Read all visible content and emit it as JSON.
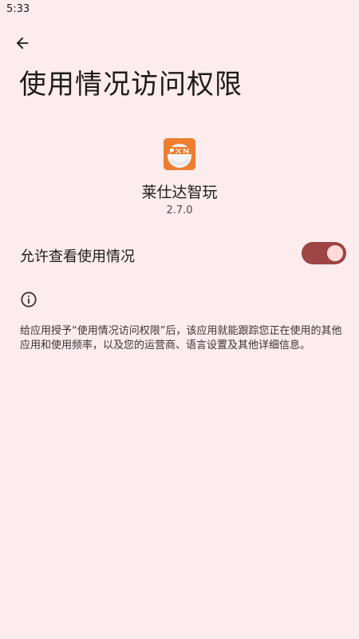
{
  "status_bar": {
    "time": "5:33"
  },
  "header": {
    "title": "使用情况访问权限"
  },
  "app": {
    "name": "莱仕达智玩",
    "version": "2.7.0",
    "icon_label": "PXN",
    "icon_color": "#ee7d2e"
  },
  "setting": {
    "label": "允许查看使用情况",
    "enabled": true,
    "toggle_color": "#9d4445"
  },
  "info": {
    "description": "给应用授予“使用情况访问权限”后，该应用就能跟踪您正在使用的其他应用和使用频率，以及您的运营商、语言设置及其他详细信息。"
  }
}
